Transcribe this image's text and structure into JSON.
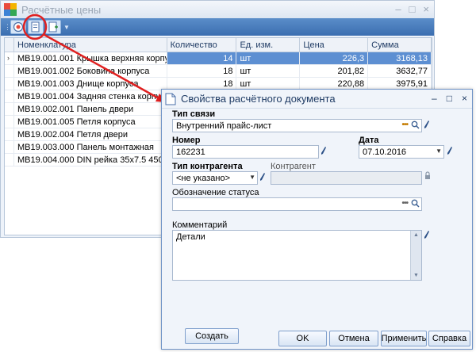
{
  "main_window": {
    "title": "Расчётные цены",
    "controls": [
      "–",
      "□",
      "×"
    ]
  },
  "toolbar": {
    "buttons": [
      {
        "icon": "disk-refresh-icon"
      },
      {
        "icon": "document-properties-icon"
      },
      {
        "icon": "document-add-icon"
      }
    ]
  },
  "grid": {
    "columns": [
      "Номенклатура",
      "Количество",
      "Ед. изм.",
      "Цена",
      "Сумма"
    ],
    "row_indicator": "›",
    "rows": [
      {
        "name": "МВ19.001.001 Крышка верхняя корпуса",
        "qty": "14",
        "unit": "шт",
        "price": "226,3",
        "sum": "3168,13"
      },
      {
        "name": "МВ19.001.002 Боковина корпуса",
        "qty": "18",
        "unit": "шт",
        "price": "201,82",
        "sum": "3632,77"
      },
      {
        "name": "МВ19.001.003 Днище корпуса",
        "qty": "18",
        "unit": "шт",
        "price": "220,88",
        "sum": "3975,91"
      },
      {
        "name": "МВ19.001.004 Задняя стенка корпуса",
        "qty": "",
        "unit": "",
        "price": "",
        "sum": ""
      },
      {
        "name": "МВ19.002.001 Панель двери",
        "qty": "",
        "unit": "",
        "price": "",
        "sum": ""
      },
      {
        "name": "МВ19.001.005 Петля корпуса",
        "qty": "",
        "unit": "",
        "price": "",
        "sum": ""
      },
      {
        "name": "МВ19.002.004 Петля двери",
        "qty": "",
        "unit": "",
        "price": "",
        "sum": ""
      },
      {
        "name": "МВ19.003.000 Панель монтажная",
        "qty": "",
        "unit": "",
        "price": "",
        "sum": ""
      },
      {
        "name": "МВ19.004.000 DIN рейка 35х7.5 450мм",
        "qty": "",
        "unit": "",
        "price": "",
        "sum": ""
      }
    ]
  },
  "dialog": {
    "title": "Свойства расчётного документа",
    "controls": [
      "–",
      "□",
      "×"
    ],
    "link_type_label": "Тип связи",
    "link_type_value": "Внутренний прайс-лист",
    "number_label": "Номер",
    "number_value": "162231",
    "date_label": "Дата",
    "date_value": "07.10.2016",
    "contractor_type_label": "Тип контрагента",
    "contractor_type_value": "<не указано>",
    "contractor_label": "Контрагент",
    "contractor_value": "",
    "status_label": "Обозначение статуса",
    "status_value": "",
    "comment_label": "Комментарий",
    "comment_value": "Детали",
    "buttons": {
      "create": "Создать",
      "ok": "OK",
      "cancel": "Отмена",
      "apply": "Применить",
      "help": "Справка"
    }
  },
  "colors": {
    "toolbar_blue": "#3b6eb0",
    "selection_blue": "#5d8fd2",
    "annotation_red": "#e02020",
    "dots_orange": "#c47b00"
  }
}
